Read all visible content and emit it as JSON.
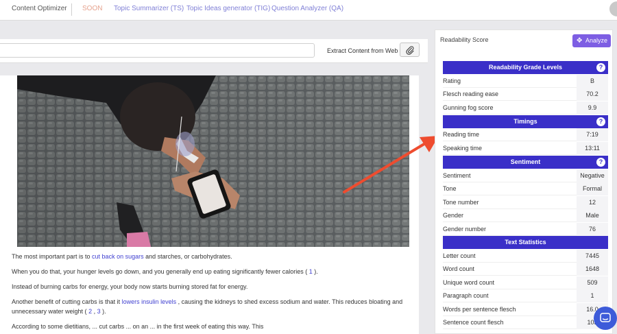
{
  "nav": {
    "items": [
      {
        "label": "Content Optimizer",
        "color": "#555555"
      },
      {
        "label": "SOON",
        "color": "#e6a38e"
      },
      {
        "label": "Topic Summarizer (TS)",
        "color": "#7f7fd6"
      },
      {
        "label": "Topic Ideas generator (TIG)",
        "color": "#7f7fd6"
      },
      {
        "label": "Question Analyzer (QA)",
        "color": "#7f7fd6"
      }
    ]
  },
  "editor": {
    "url_value": "",
    "extract_label": "Extract Content from Web",
    "paragraphs": [
      {
        "parts": [
          "The most important part is to ",
          "cut back on sugars",
          " and starches, or carbohydrates."
        ]
      },
      {
        "parts": [
          "When you do that, your hunger levels go down, and you generally end up eating significantly fewer calories ( ",
          "1",
          " )."
        ]
      },
      {
        "parts": [
          "Instead of burning carbs for energy, your body now starts burning stored fat for energy."
        ]
      },
      {
        "parts": [
          "Another benefit of cutting carbs is that it ",
          "lowers insulin levels",
          " , causing the kidneys to shed excess sodium and water. This reduces bloating and unnecessary water weight ( ",
          "2",
          " , ",
          "3",
          " )."
        ]
      },
      {
        "parts": [
          "According to some dietitians, ... cut carbs ... on an ... in the first week of eating this way. This"
        ]
      }
    ]
  },
  "panel": {
    "title": "Readability Score",
    "analyze_label": "Analyze",
    "help_glyph": "?",
    "sections": [
      {
        "title": "Readability Grade Levels",
        "has_help": true,
        "rows": [
          {
            "label": "Rating",
            "value": "B"
          },
          {
            "label": "Flesch reading ease",
            "value": "70.2"
          },
          {
            "label": "Gunning fog score",
            "value": "9.9"
          }
        ]
      },
      {
        "title": "Timings",
        "has_help": true,
        "rows": [
          {
            "label": "Reading time",
            "value": "7:19"
          },
          {
            "label": "Speaking time",
            "value": "13:11"
          }
        ]
      },
      {
        "title": "Sentiment",
        "has_help": true,
        "rows": [
          {
            "label": "Sentiment",
            "value": "Negative"
          },
          {
            "label": "Tone",
            "value": "Formal"
          },
          {
            "label": "Tone number",
            "value": "12"
          },
          {
            "label": "Gender",
            "value": "Male"
          },
          {
            "label": "Gender number",
            "value": "76"
          }
        ]
      },
      {
        "title": "Text Statistics",
        "has_help": false,
        "rows": [
          {
            "label": "Letter count",
            "value": "7445"
          },
          {
            "label": "Word count",
            "value": "1648"
          },
          {
            "label": "Unique word count",
            "value": "509"
          },
          {
            "label": "Paragraph count",
            "value": "1"
          },
          {
            "label": "Words per sentence flesch",
            "value": "16.0"
          },
          {
            "label": "Sentence count flesch",
            "value": "103"
          }
        ]
      }
    ]
  },
  "colors": {
    "accent": "#3a2fc8",
    "analyze": "#7d5ee3",
    "arrow": "#ee4c2f",
    "link": "#3f3fd0"
  },
  "icons": {
    "attach": "paperclip-icon",
    "analyze": "sparkle-icon",
    "help": "question-icon",
    "chat": "chat-icon"
  }
}
